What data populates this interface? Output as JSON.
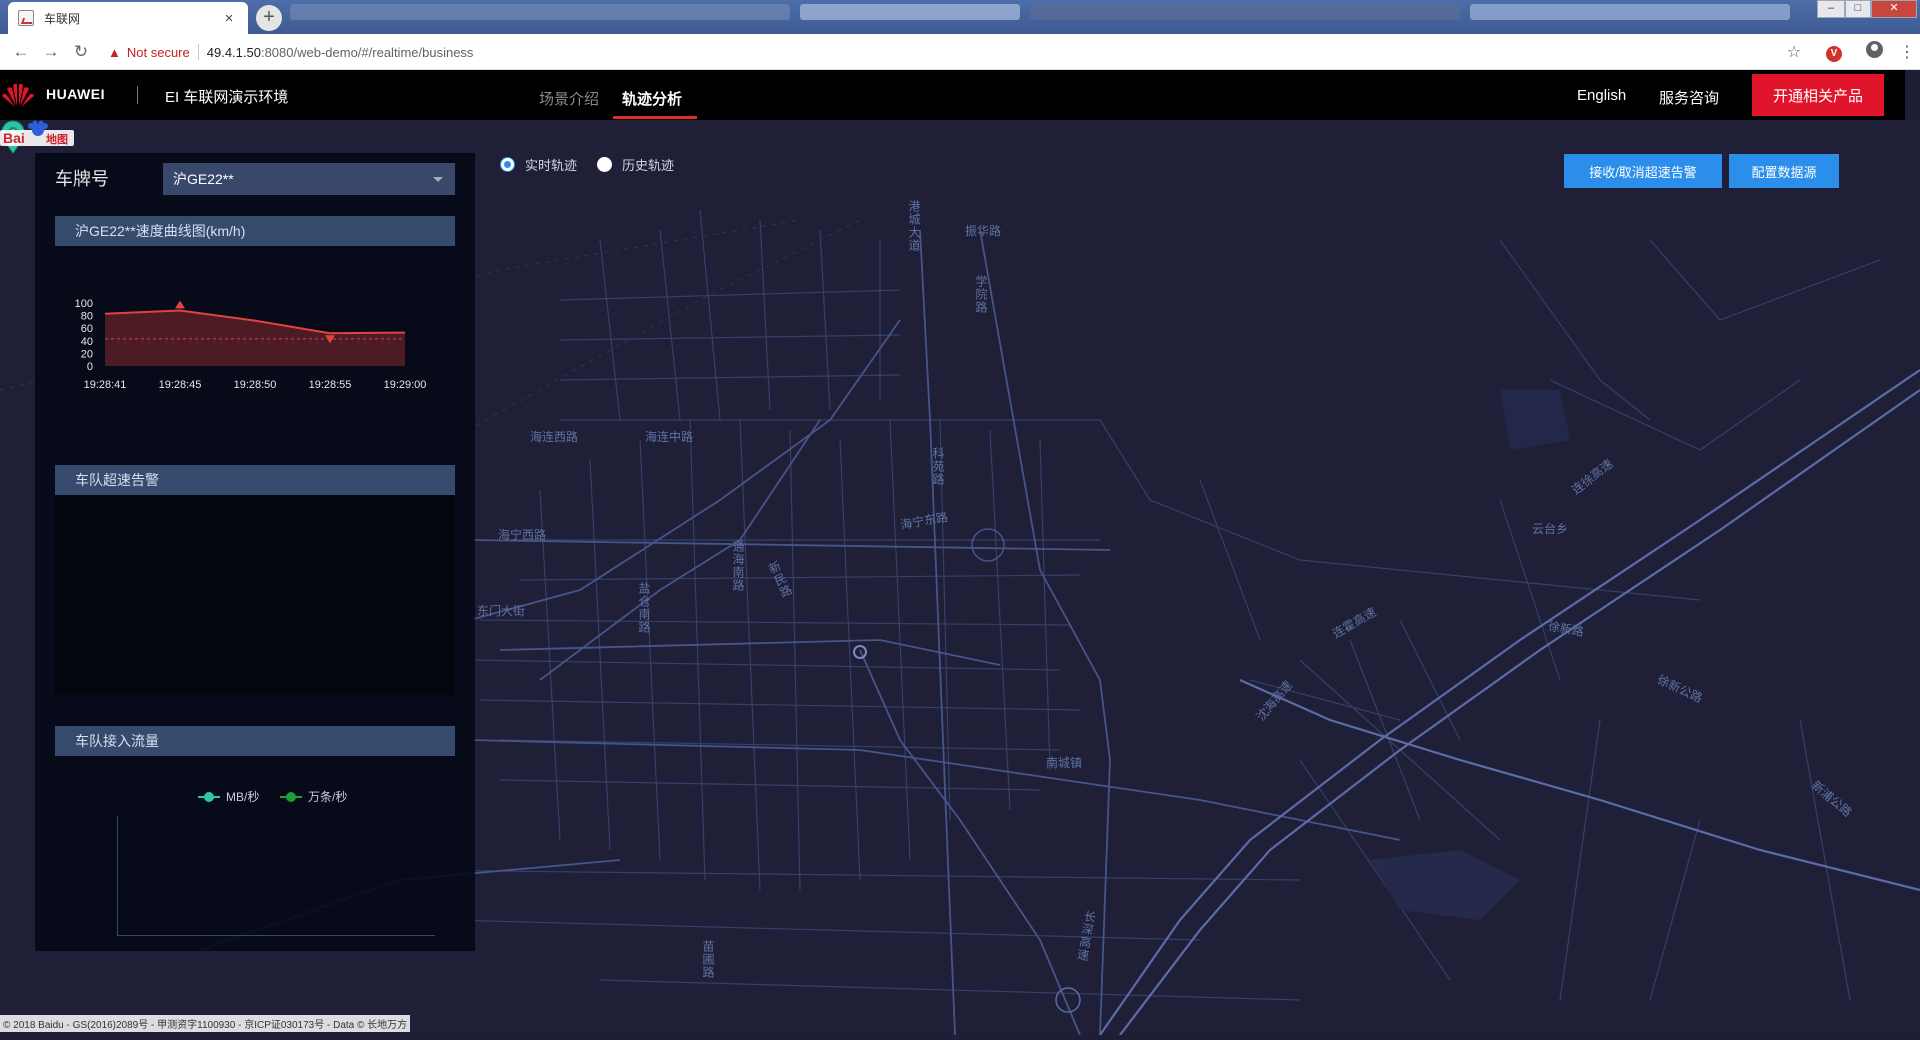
{
  "browser": {
    "tab_title": "车联网",
    "tab_close": "×",
    "new_tab": "+",
    "security_label": "Not secure",
    "url_host": "49.4.1.50",
    "url_path": ":8080/web-demo/#/realtime/business",
    "win_minimize": "–",
    "win_maximize": "□",
    "win_close": "✕"
  },
  "header": {
    "brand": "HUAWEI",
    "app_title": "EI 车联网演示环境",
    "nav": [
      {
        "label": "场景介绍",
        "active": false
      },
      {
        "label": "轨迹分析",
        "active": true
      }
    ],
    "lang_link": "English",
    "service_link": "服务咨询",
    "cta": "开通相关产品"
  },
  "map_controls": {
    "radio_realtime": "实时轨迹",
    "radio_history": "历史轨迹",
    "selected": "realtime",
    "btn_alarm": "接收/取消超速告警",
    "btn_datasource": "配置数据源"
  },
  "panel": {
    "plate_label": "车牌号",
    "plate_value": "沪GE22**",
    "speed_title": "沪GE22**速度曲线图(km/h)",
    "alarm_title": "车队超速告警",
    "flow_title": "车队接入流量",
    "flow_legend": [
      {
        "name": "MB/秒",
        "color": "#2ec7a4"
      },
      {
        "name": "万条/秒",
        "color": "#1f9e3a"
      }
    ]
  },
  "chart_data": {
    "type": "area",
    "title": "沪GE22**速度曲线图(km/h)",
    "x": [
      "19:28:41",
      "19:28:45",
      "19:28:50",
      "19:28:55",
      "19:29:00"
    ],
    "series": [
      {
        "values": [
          83,
          88,
          72,
          52,
          53
        ]
      }
    ],
    "reference_line": 43,
    "max_marker": {
      "x": "19:28:45",
      "value": 88
    },
    "min_marker": {
      "x": "19:28:55",
      "value": 52
    },
    "yticks": [
      0,
      20,
      40,
      60,
      80,
      100
    ],
    "ylim": [
      0,
      100
    ],
    "colors": {
      "line": "#e0433f",
      "fill": "#5a1f27",
      "axis_text": "#e8e8e8"
    }
  },
  "map": {
    "labels": [
      {
        "text": "海连西路"
      },
      {
        "text": "海连中路"
      },
      {
        "text": "海宁西路"
      },
      {
        "text": "海宁东路"
      },
      {
        "text": "东门大街"
      },
      {
        "text": "振华路"
      },
      {
        "text": "学院路"
      },
      {
        "text": "科苑路"
      },
      {
        "text": "港城大道"
      },
      {
        "text": "通海南路"
      },
      {
        "text": "新民路"
      },
      {
        "text": "盐仓南路"
      },
      {
        "text": "云台乡"
      },
      {
        "text": "徐新路"
      },
      {
        "text": "徐新公路"
      },
      {
        "text": "南城镇"
      },
      {
        "text": "连徐高速"
      },
      {
        "text": "连霍高速"
      },
      {
        "text": "沈海高速"
      },
      {
        "text": "长深高速"
      },
      {
        "text": "新浦公路"
      },
      {
        "text": "苗圃路"
      }
    ],
    "baidu_logo": "Bai地图",
    "copyright": "© 2018 Baidu - GS(2016)2089号 - 甲测资字1100930 - 京ICP证030173号 - Data © 长地万方"
  }
}
